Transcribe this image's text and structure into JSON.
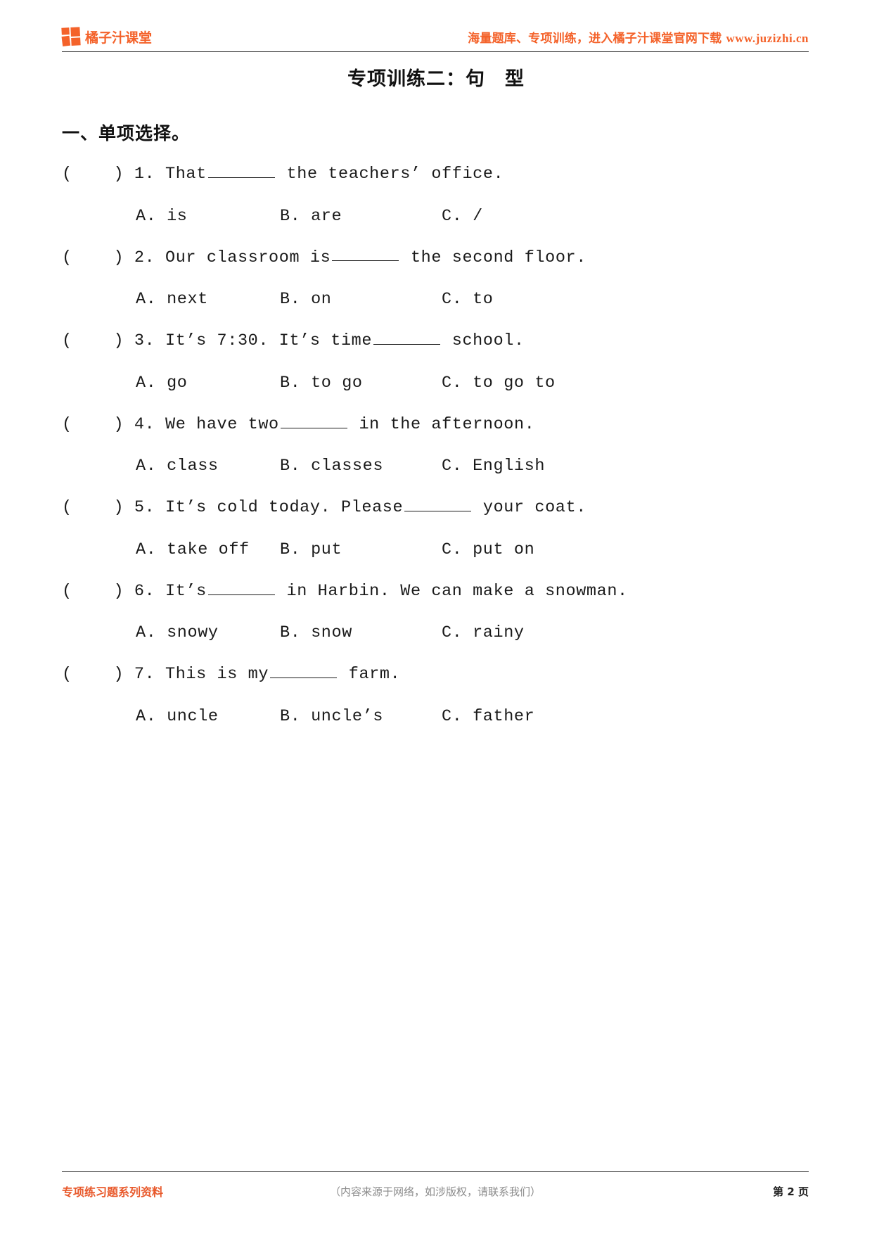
{
  "header": {
    "logo_icon": "four-square-grid-icon",
    "brand_name": "橘子汁课堂",
    "slogan_text": "海量题库、专项训练，进入橘子汁课堂官网下载 ",
    "slogan_url": "www.juzizhi.cn",
    "brand_color": "#f4622a"
  },
  "title": "专项训练二：句　型",
  "section": {
    "heading": "一、单项选择。"
  },
  "questions": [
    {
      "marker": "(    ) 1.",
      "stem_before": " That",
      "stem_after": " the teachers’ office.",
      "options": {
        "a": "A. is",
        "b": "B. are",
        "c": "C. /"
      }
    },
    {
      "marker": "(    ) 2.",
      "stem_before": " Our classroom is",
      "stem_after": " the second floor.",
      "options": {
        "a": "A. next",
        "b": "B. on",
        "c": "C. to"
      }
    },
    {
      "marker": "(    ) 3.",
      "stem_before": " It’s 7:30. It’s time",
      "stem_after": " school.",
      "options": {
        "a": "A. go",
        "b": "B. to go",
        "c": "C. to go to"
      }
    },
    {
      "marker": "(    ) 4.",
      "stem_before": " We have two",
      "stem_after": " in the afternoon.",
      "options": {
        "a": "A. class",
        "b": "B. classes",
        "c": "C. English"
      }
    },
    {
      "marker": "(    ) 5.",
      "stem_before": " It’s cold today. Please",
      "stem_after": " your coat.",
      "options": {
        "a": "A. take off",
        "b": "B. put",
        "c": "C. put on"
      }
    },
    {
      "marker": "(    ) 6.",
      "stem_before": " It’s",
      "stem_after": " in Harbin. We can make a snowman.",
      "options": {
        "a": "A. snowy",
        "b": "B. snow",
        "c": "C. rainy"
      }
    },
    {
      "marker": "(    ) 7.",
      "stem_before": " This is my",
      "stem_after": " farm.",
      "options": {
        "a": "A. uncle",
        "b": "B. uncle’s",
        "c": "C. father"
      }
    }
  ],
  "footer": {
    "left": "专项练习题系列资料",
    "center": "（内容来源于网络，如涉版权，请联系我们）",
    "right": "第 2 页",
    "left_color": "#e8582a"
  }
}
